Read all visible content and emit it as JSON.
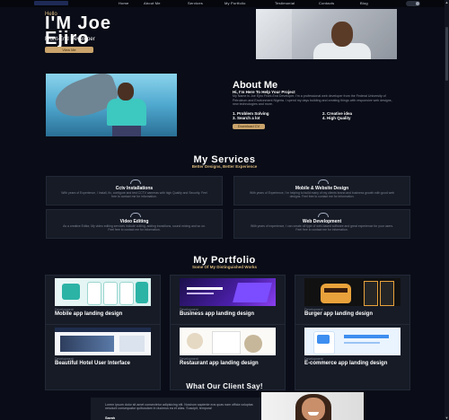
{
  "nav": {
    "items": [
      "Home",
      "About Me",
      "Services",
      "My Portfolio",
      "Testimonial",
      "Contacts",
      "Blog"
    ]
  },
  "hero": {
    "greeting": "Hello",
    "name": "I'M Joe Ejiro",
    "role": "Front-End Developer",
    "button": "View Me"
  },
  "about": {
    "title": "About Me",
    "subtitle": "Hi, I'm Here To Help Your Project",
    "text": "My Name is Joe Ejiro Front-End Developer. I'm a professional web developer from the Federal University of Petroleum and Environment Nigeria. I spend my days building and creating things with responsive web designs, new technologies and more.",
    "skills": [
      "1. Problem Solving",
      "2. Creative idea",
      "3. Search a lot",
      "4. High Quality"
    ],
    "button": "Download CV"
  },
  "services": {
    "title": "My Services",
    "subtitle": "Better Designs, Better Experience",
    "items": [
      {
        "title": "Cctv Installations",
        "desc": "With years of Experience, I Install, fix, configure and test CCTV cameras with high Quality and Security. Feel free to contact me for information."
      },
      {
        "title": "Mobile & Website Design",
        "desc": "With years of Experience, I'm helping to build many of my clients brand and business growth with good web designs. Feel free to contact me for information."
      },
      {
        "title": "Video Editing",
        "desc": "As a creative Editor, My video editing services include cutting, adding transitions, sound mixing and so on. Feel free to contact me for information."
      },
      {
        "title": "Web Development",
        "desc": "With years of experience, I can create all type of web-based software and great experience for your users. Feel free to contact me for information."
      }
    ]
  },
  "portfolio": {
    "title": "My Portfolio",
    "subtitle": "Some Of My Distinguished Works",
    "items": [
      {
        "category": "Development",
        "title": "Mobile app landing design"
      },
      {
        "category": "Development",
        "title": "Business app landing design"
      },
      {
        "category": "Development",
        "title": "Burger app landing design"
      },
      {
        "category": "Development",
        "title": "Beautiful Hotel User Interface"
      },
      {
        "category": "Development",
        "title": "Restaurant app landing design"
      },
      {
        "category": "Development",
        "title": "E-commerce app landing design"
      }
    ]
  },
  "testimonials": {
    "title": "What Our Client Say!",
    "text": "Lorem ipsum dolor sit amet consectetur adipisicing elit. Nostrum sapiente eos quas nam officia voluptas nesciunt consequatur quibusdam in ducimus ea et alias. Suscipit, tempora!",
    "name": "Sarah"
  },
  "colors": {
    "background": "#0a0d17",
    "accent": "#c9a36b",
    "card": "#161b26"
  }
}
